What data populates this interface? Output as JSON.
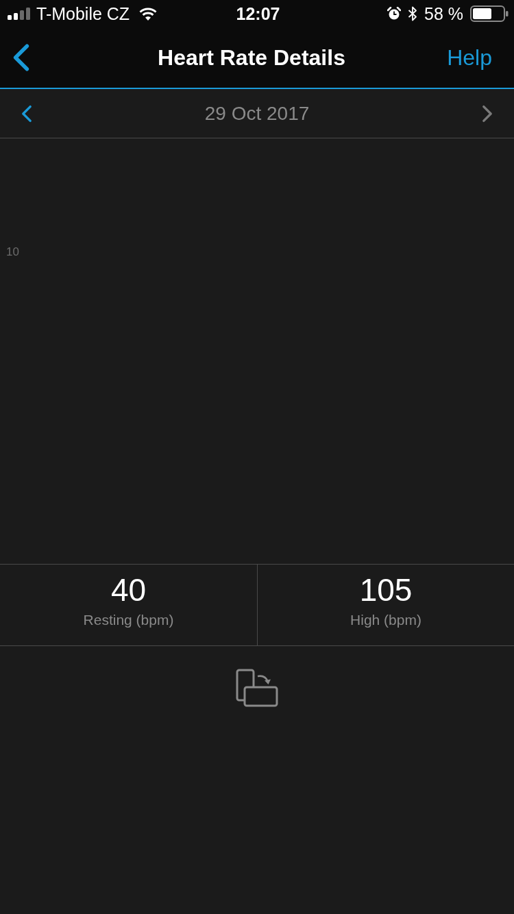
{
  "status_bar": {
    "carrier": "T-Mobile CZ",
    "time": "12:07",
    "battery": "58 %"
  },
  "nav_bar": {
    "title": "Heart Rate Details",
    "action": "Help"
  },
  "date_bar": {
    "date": "29 Oct 2017",
    "previous": {
      "disabled": false
    },
    "next": {
      "disabled": true
    }
  },
  "chart": {
    "axis_label": "10"
  },
  "stats": [
    {
      "value": "40",
      "label": "Resting (bpm)"
    },
    {
      "value": "105",
      "label": "High (bpm)"
    }
  ]
}
